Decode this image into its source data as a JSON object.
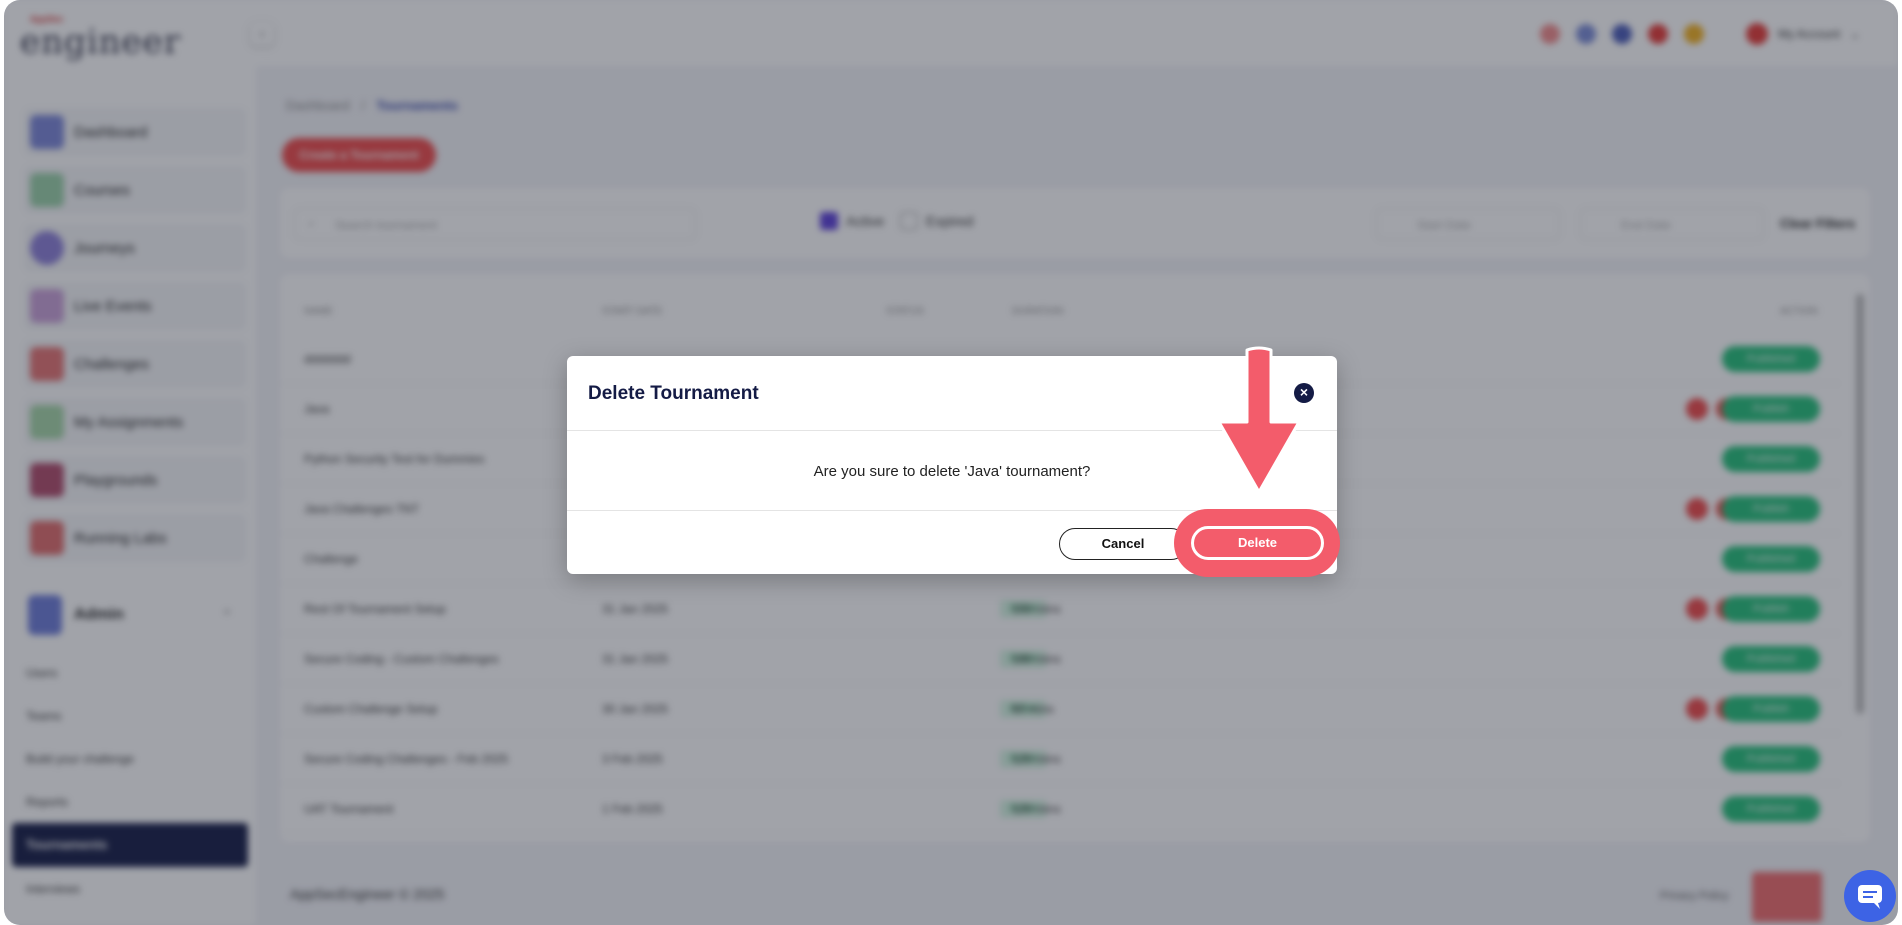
{
  "app": {
    "logo_small": "AppSec",
    "logo": "engineer",
    "account_label": "My Account"
  },
  "sidebar": {
    "items": [
      {
        "label": "Dashboard"
      },
      {
        "label": "Courses"
      },
      {
        "label": "Journeys"
      },
      {
        "label": "Live Events"
      },
      {
        "label": "Challenges"
      },
      {
        "label": "My Assignments"
      },
      {
        "label": "Playgrounds"
      },
      {
        "label": "Running Labs"
      }
    ],
    "admin_label": "Admin",
    "admin_subitems": [
      "Users",
      "Teams",
      "Build your challenge",
      "Reports"
    ],
    "active_subitem": "Tournaments",
    "trailing_subitem": "Interviews"
  },
  "main": {
    "breadcrumb_root": "Dashboard",
    "breadcrumb_sep": "/",
    "breadcrumb_current": "Tournaments",
    "create_button": "Create a Tournament",
    "search_placeholder": "Search tournament",
    "filter_active": "Active",
    "filter_expired": "Expired",
    "start_date_placeholder": "Start Date",
    "end_date_placeholder": "End Date",
    "clear_filters": "Clear Filters",
    "columns": [
      "NAME",
      "START DATE",
      "STATUS",
      "DURATION",
      "ACTION"
    ],
    "rows": [
      {
        "name": "ddddddd",
        "date": "",
        "status": "",
        "duration": "",
        "action": "Published"
      },
      {
        "name": "Java",
        "date": "",
        "status": "",
        "duration": "",
        "action": "Publish"
      },
      {
        "name": "Python Security Test for Dummies",
        "date": "",
        "status": "",
        "duration": "",
        "action": "Published"
      },
      {
        "name": "Java Challenges TNT",
        "date": "",
        "status": "",
        "duration": "",
        "action": "Publish"
      },
      {
        "name": "Challenge",
        "date": "",
        "status": "",
        "duration": "",
        "action": "Published"
      },
      {
        "name": "Rest Of Tournament Setup",
        "date": "31 Jan 2025",
        "status": "Active",
        "duration": "150 mins",
        "action": "Publish"
      },
      {
        "name": "Secure Coding - Custom Challenges",
        "date": "31 Jan 2025",
        "status": "Active",
        "duration": "180 mins",
        "action": "Published"
      },
      {
        "name": "Custom Challenge Setup",
        "date": "30 Jan 2025",
        "status": "Active",
        "duration": "60 mins",
        "action": "Publish"
      },
      {
        "name": "Secure Coding Challenges - Feb 2025",
        "date": "3 Feb 2025",
        "status": "Active",
        "duration": "120 mins",
        "action": "Published"
      },
      {
        "name": "UAT Tournament",
        "date": "1 Feb 2025",
        "status": "Active",
        "duration": "120 mins",
        "action": "Published"
      }
    ],
    "footer": "AppSecEngineer © 2025",
    "privacy": "Privacy Policy"
  },
  "modal": {
    "title": "Delete Tournament",
    "message": "Are you sure to delete 'Java' tournament?",
    "cancel_label": "Cancel",
    "delete_label": "Delete",
    "close_glyph": "×"
  },
  "colors": {
    "brand_navy": "#141b45",
    "danger": "#f35c6b",
    "success": "#24c079",
    "accent_purple": "#5b3fd9"
  }
}
